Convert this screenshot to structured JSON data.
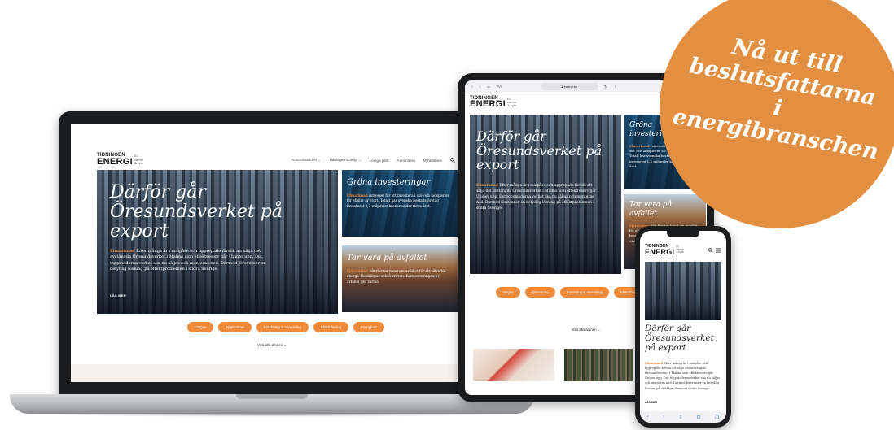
{
  "badge": {
    "text": "Nå ut till beslutsfattarna i energibranschen"
  },
  "site": {
    "logo_top": "TIDNINGEN",
    "logo_main": "ENERGI",
    "logo_tag_1": "El,",
    "logo_tag_2": "värme",
    "logo_tag_3": "& kyla",
    "nav": [
      "Annonsvärlden",
      "Tidningen Energi",
      "Lediga jobb",
      "Annonsera",
      "Nyhetsbrev"
    ],
    "hero": {
      "title": "Därför går Öresundsverket på export",
      "kicker": "Elmarknad",
      "text": "Efter många år i malpåse och upprepade försök att sälja det avstängda Öresundsverket i Malmö som effektreserv går Uniper upp. Det toppmoderna verket ska nu säljas och monteras ned. Därmed försvinner en betydlig lösning på effektproblemen i södra Sverige.",
      "read_more": "LÄS MER"
    },
    "card1": {
      "title": "Gröna investeringar",
      "kicker": "Elmarknad",
      "text": "Intresset för att investera i sol- och ladsposter för elbilar är stort. Totalt har svenska bostadsföretag investerat 1,2 miljarder kronor under förra året."
    },
    "card2": {
      "title": "Tar vara på avfallet",
      "kicker": "Fjärrvärme",
      "text": "Allt fler tar hand om avfallet för att tillverka energi. Nu skärpas också kraven. Komposteringen av avfallet ger värme."
    },
    "tags": [
      "Vätgas",
      "Fjärrvärme",
      "Forskning & utveckling",
      "Elektrifiering",
      "Förnybart"
    ],
    "see_all": "Visa alla ämnen",
    "chevron": "⌄"
  },
  "tablet": {
    "browser_aa": "AA",
    "url": "energi.se",
    "hero_kicker": "Elmarknad"
  },
  "phone": {
    "toolbar": [
      "‹",
      "›",
      "⇪",
      "⊡",
      "❐"
    ]
  },
  "colors": {
    "accent": "#ef8a3b",
    "badge": "#e38f41"
  }
}
